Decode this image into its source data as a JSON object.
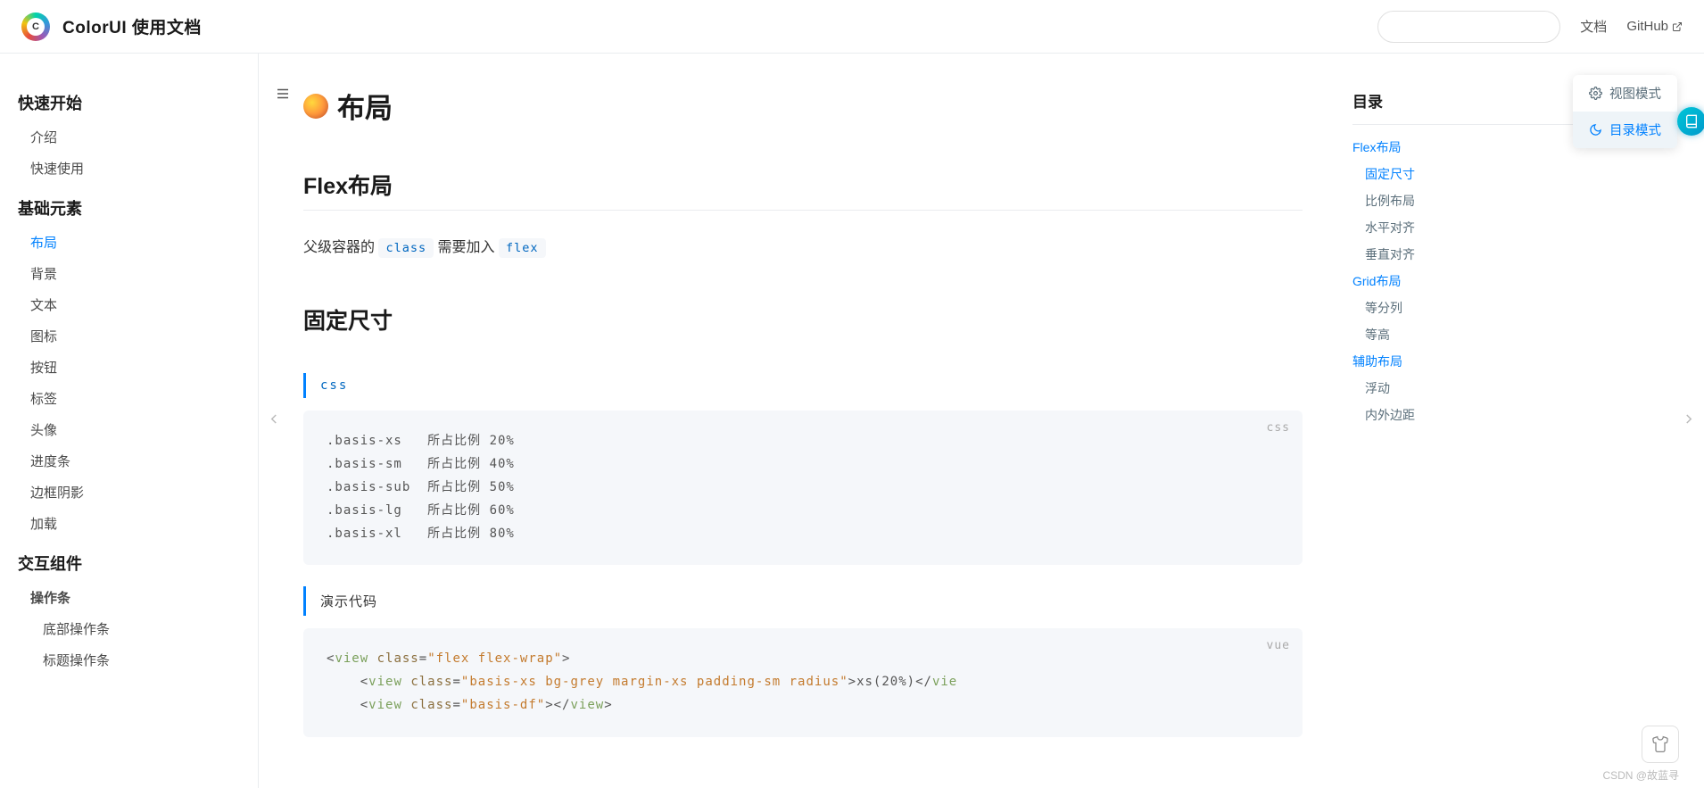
{
  "site_title": "ColorUI 使用文档",
  "header": {
    "nav_doc": "文档",
    "nav_github": "GitHub",
    "search_placeholder": ""
  },
  "sidebar": {
    "groups": [
      {
        "title": "快速开始",
        "items": [
          {
            "label": "介绍"
          },
          {
            "label": "快速使用"
          }
        ]
      },
      {
        "title": "基础元素",
        "items": [
          {
            "label": "布局",
            "active": true
          },
          {
            "label": "背景"
          },
          {
            "label": "文本"
          },
          {
            "label": "图标"
          },
          {
            "label": "按钮"
          },
          {
            "label": "标签"
          },
          {
            "label": "头像"
          },
          {
            "label": "进度条"
          },
          {
            "label": "边框阴影"
          },
          {
            "label": "加载"
          }
        ]
      },
      {
        "title": "交互组件",
        "items": [
          {
            "label": "操作条",
            "bold": true
          },
          {
            "label": "底部操作条",
            "sub": true
          },
          {
            "label": "标题操作条",
            "sub": true
          }
        ]
      }
    ]
  },
  "page": {
    "title": "布局",
    "h2_flex": "Flex布局",
    "para_prefix": "父级容器的 ",
    "code_class": "class",
    "para_mid": " 需要加入 ",
    "code_flex": "flex",
    "h2_fixed": "固定尺寸",
    "tab_css": "css",
    "tab_demo": "演示代码",
    "css_lines": [
      ".basis-xs   所占比例 20%",
      ".basis-sm   所占比例 40%",
      ".basis-sub  所占比例 50%",
      ".basis-lg   所占比例 60%",
      ".basis-xl   所占比例 80%"
    ],
    "vue_lang": "vue",
    "css_lang": "css"
  },
  "toc": {
    "title": "目录",
    "items": [
      {
        "label": "Flex布局",
        "level": 1,
        "active": true
      },
      {
        "label": "固定尺寸",
        "level": 2,
        "active": true
      },
      {
        "label": "比例布局",
        "level": 2
      },
      {
        "label": "水平对齐",
        "level": 2
      },
      {
        "label": "垂直对齐",
        "level": 2
      },
      {
        "label": "Grid布局",
        "level": 1
      },
      {
        "label": "等分列",
        "level": 2
      },
      {
        "label": "等高",
        "level": 2
      },
      {
        "label": "辅助布局",
        "level": 1
      },
      {
        "label": "浮动",
        "level": 2
      },
      {
        "label": "内外边距",
        "level": 2
      }
    ]
  },
  "mode_popup": {
    "view": "视图模式",
    "toc": "目录模式"
  },
  "watermark": "CSDN @故蓝寻"
}
